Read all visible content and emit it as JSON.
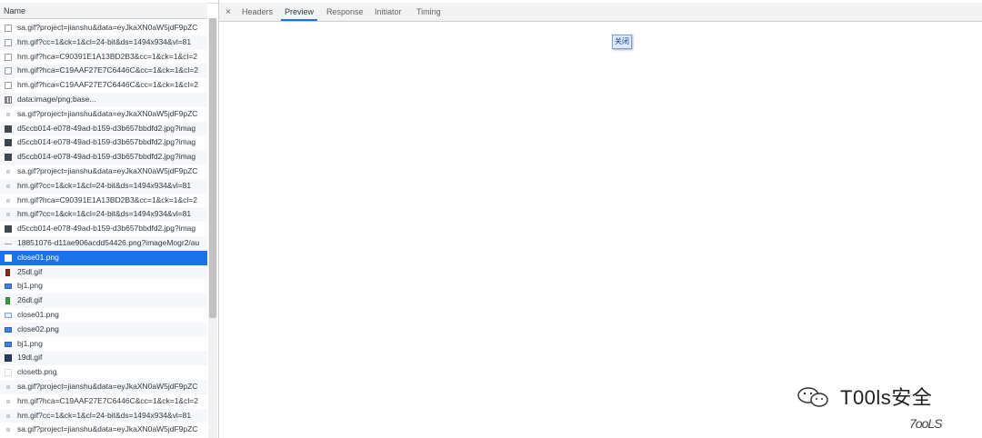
{
  "column_header": "Name",
  "requests": [
    {
      "icon": "doc",
      "name": "sa.gif?project=jianshu&data=eyJkaXN0aW5jdF9pZC"
    },
    {
      "icon": "doc",
      "name": "hm.gif?cc=1&ck=1&cl=24-bit&ds=1494x934&vl=81"
    },
    {
      "icon": "doc",
      "name": "hm.gif?hca=C90391E1A13BD2B3&cc=1&ck=1&cl=2"
    },
    {
      "icon": "doc",
      "name": "hm.gif?hca=C19AAF27E7C6446C&cc=1&ck=1&cl=2"
    },
    {
      "icon": "doc",
      "name": "hm.gif?hca=C19AAF27E7C6446C&cc=1&ck=1&cl=2"
    },
    {
      "icon": "grid",
      "name": "data:image/png;base..."
    },
    {
      "icon": "dot",
      "name": "sa.gif?project=jianshu&data=eyJkaXN0aW5jdF9pZC"
    },
    {
      "icon": "img",
      "name": "d5ccb014-e078-49ad-b159-d3b657bbdfd2.jpg?imag"
    },
    {
      "icon": "img",
      "name": "d5ccb014-e078-49ad-b159-d3b657bbdfd2.jpg?imag"
    },
    {
      "icon": "img",
      "name": "d5ccb014-e078-49ad-b159-d3b657bbdfd2.jpg?imag"
    },
    {
      "icon": "dot",
      "name": "sa.gif?project=jianshu&data=eyJkaXN0aW5jdF9pZC"
    },
    {
      "icon": "dot",
      "name": "hm.gif?cc=1&ck=1&cl=24-bit&ds=1494x934&vl=81"
    },
    {
      "icon": "dot",
      "name": "hm.gif?hca=C90391E1A13BD2B3&cc=1&ck=1&cl=2"
    },
    {
      "icon": "dot",
      "name": "hm.gif?cc=1&ck=1&cl=24-bit&ds=1494x934&vl=81"
    },
    {
      "icon": "img",
      "name": "d5ccb014-e078-49ad-b159-d3b657bbdfd2.jpg?imag"
    },
    {
      "icon": "dash",
      "name": "18851076-d11ae906acdd54426.png?imageMogr2/au"
    },
    {
      "icon": "sel",
      "name": "close01.png",
      "selected": true
    },
    {
      "icon": "gif-r",
      "name": "25dl.gif"
    },
    {
      "icon": "png-b",
      "name": "bj1.png"
    },
    {
      "icon": "gif-g",
      "name": "26dl.gif"
    },
    {
      "icon": "png-w",
      "name": "close01.png"
    },
    {
      "icon": "png-b",
      "name": "close02.png"
    },
    {
      "icon": "png-b",
      "name": "bj1.png"
    },
    {
      "icon": "gif-d",
      "name": "19dl.gif"
    },
    {
      "icon": "blank",
      "name": "closetb.png"
    },
    {
      "icon": "dot",
      "name": "sa.gif?project=jianshu&data=eyJkaXN0aW5jdF9pZC"
    },
    {
      "icon": "dot",
      "name": "hm.gif?hca=C19AAF27E7C6446C&cc=1&ck=1&cl=2"
    },
    {
      "icon": "dot",
      "name": "hm.gif?cc=1&ck=1&cl=24-bit&ds=1494x934&vl=81"
    },
    {
      "icon": "dot",
      "name": "sa.gif?project=jianshu&data=eyJkaXN0aW5jdF9pZC"
    }
  ],
  "tabs": {
    "close_glyph": "×",
    "items": [
      "Headers",
      "Preview",
      "Response",
      "Initiator",
      "Timing"
    ],
    "active": "Preview"
  },
  "preview": {
    "button_label": "关闭"
  },
  "watermark": {
    "text": "T00ls安全",
    "logo": "7ooLS"
  },
  "colors": {
    "selection": "#1a73e8",
    "tab_active_underline": "#1a73e8"
  }
}
